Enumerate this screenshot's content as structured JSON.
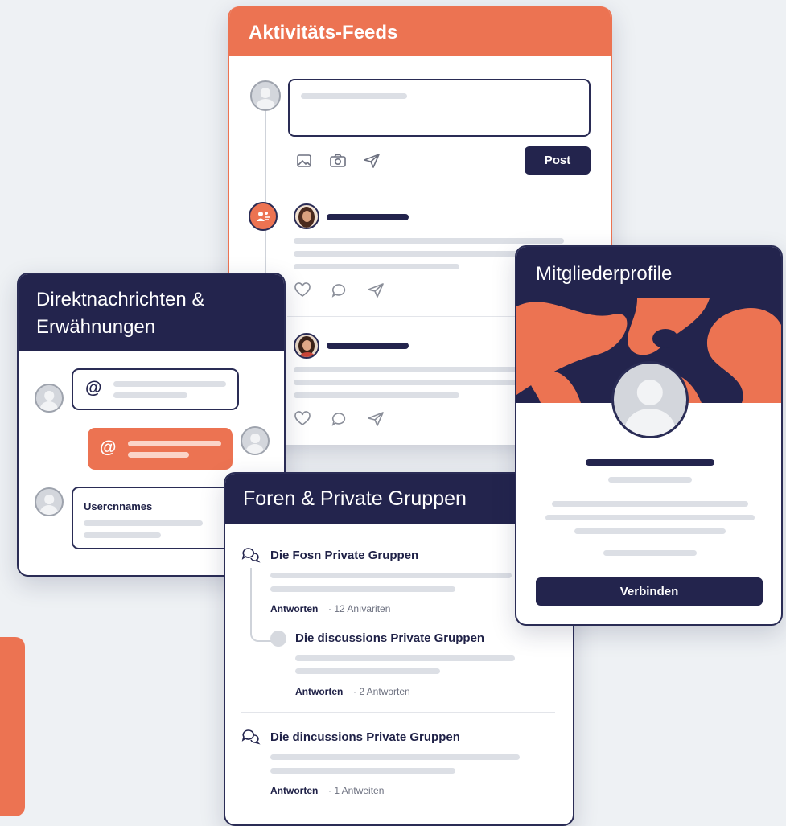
{
  "activity_feed": {
    "title": "Aktivitäts-Feeds",
    "post_button": "Post"
  },
  "direct_messages": {
    "title_line1": "Direktnachrichten &",
    "title_line2": "Erwähnungen",
    "mention_symbol": "@",
    "username_label": "Usercnnames"
  },
  "member_profiles": {
    "title": "Mitgliederprofile",
    "connect_button": "Verbinden"
  },
  "forums": {
    "title": "Foren & Private Gruppen",
    "threads": [
      {
        "title": "Die Fosn Private Gruppen",
        "meta_label": "Antworten",
        "meta_count": "· 12 Anıvariten"
      },
      {
        "title": "Die discussions Private Gruppen",
        "meta_label": "Antworten",
        "meta_count": "· 2 Antworten"
      },
      {
        "title": "Die dincussions Private Gruppen",
        "meta_label": "Antworten",
        "meta_count": "· 1 Antweiten"
      }
    ]
  },
  "colors": {
    "accent": "#ec7352",
    "navy": "#23244d",
    "placeholder": "#dcdfe5"
  },
  "icons": [
    "image-icon",
    "camera-icon",
    "send-icon",
    "heart-icon",
    "comment-icon",
    "share-icon",
    "chat-bubble-icon",
    "user-group-icon"
  ]
}
